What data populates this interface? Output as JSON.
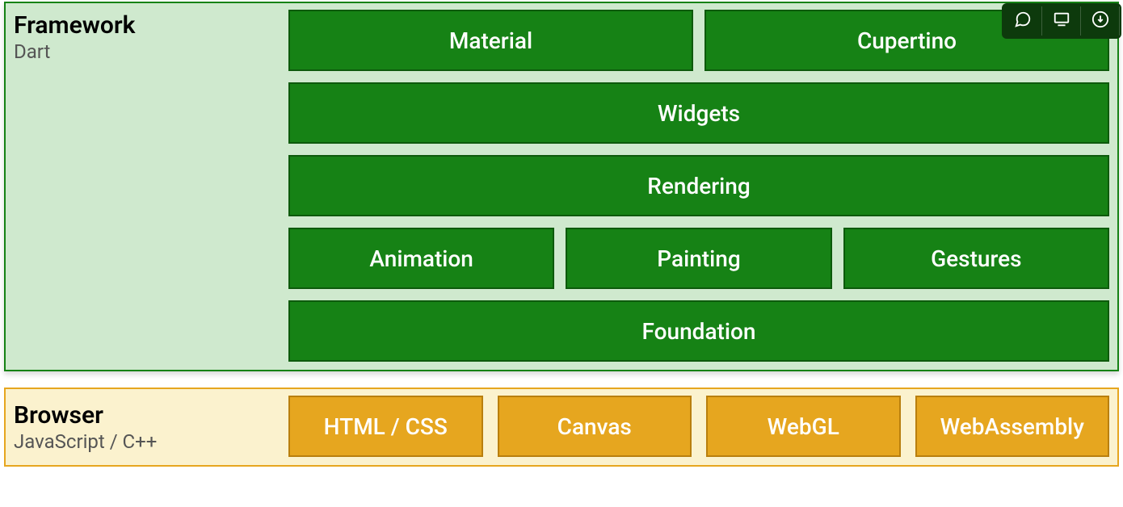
{
  "framework": {
    "title": "Framework",
    "subtitle": "Dart",
    "rows": [
      [
        "Material",
        "Cupertino"
      ],
      [
        "Widgets"
      ],
      [
        "Rendering"
      ],
      [
        "Animation",
        "Painting",
        "Gestures"
      ],
      [
        "Foundation"
      ]
    ]
  },
  "browser": {
    "title": "Browser",
    "subtitle": "JavaScript / C++",
    "blocks": [
      "HTML / CSS",
      "Canvas",
      "WebGL",
      "WebAssembly"
    ]
  },
  "toolbar": {
    "icons": [
      "comment-icon",
      "display-icon",
      "download-icon"
    ],
    "more": "more-icon"
  },
  "colors": {
    "green": "#168215",
    "green_light": "#cfe9ce",
    "orange": "#e6a61f",
    "orange_light": "#fbf2ce"
  }
}
